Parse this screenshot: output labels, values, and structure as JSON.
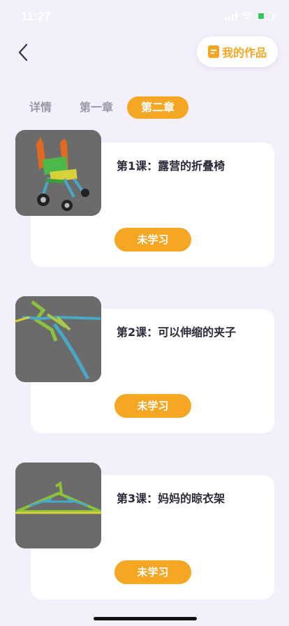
{
  "status_bar": {
    "time": "11:27"
  },
  "header": {
    "my_works_label": "我的作品"
  },
  "tabs": [
    {
      "label": "详情",
      "active": false
    },
    {
      "label": "第一章",
      "active": false
    },
    {
      "label": "第二章",
      "active": true
    }
  ],
  "lessons": [
    {
      "title": "第1课：露营的折叠椅",
      "button_label": "未学习",
      "thumbnail": "folding-chair-model"
    },
    {
      "title": "第2课：可以伸缩的夹子",
      "button_label": "未学习",
      "thumbnail": "extendable-clip-model"
    },
    {
      "title": "第3课：妈妈的晾衣架",
      "button_label": "未学习",
      "thumbnail": "clothes-hanger-model"
    }
  ],
  "colors": {
    "accent": "#f5a623",
    "background": "#f4f0fb",
    "card": "#ffffff",
    "thumbnail_bg": "#6a6a6a"
  }
}
